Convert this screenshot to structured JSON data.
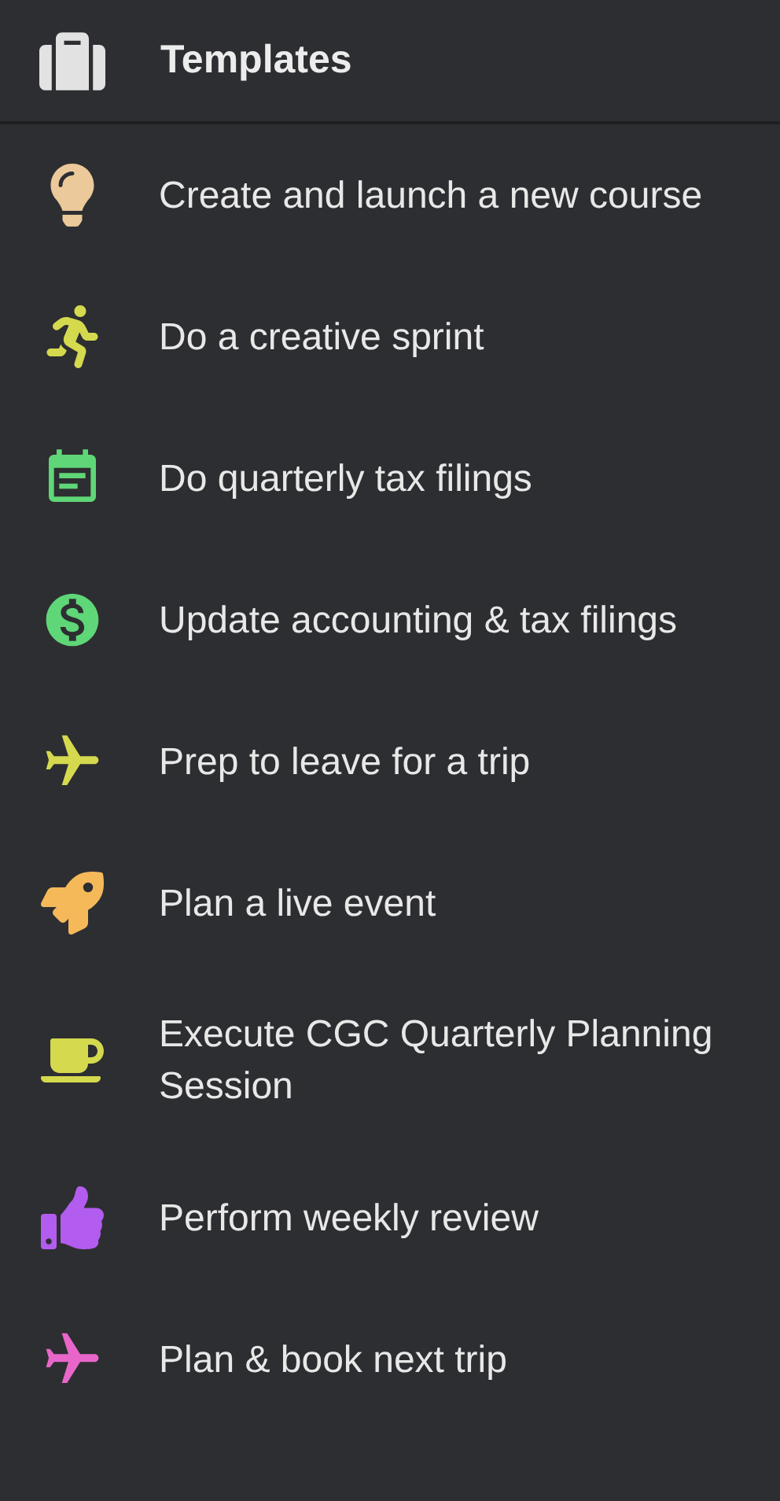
{
  "header": {
    "title": "Templates"
  },
  "templates": [
    {
      "label": "Create and launch a new course",
      "color": "#ebc99a"
    },
    {
      "label": "Do a creative sprint",
      "color": "#d4d94e"
    },
    {
      "label": "Do quarterly tax filings",
      "color": "#5fd677"
    },
    {
      "label": "Update accounting & tax filings",
      "color": "#5fd677"
    },
    {
      "label": "Prep to leave for a trip",
      "color": "#d4d94e"
    },
    {
      "label": "Plan a live event",
      "color": "#f5b95a"
    },
    {
      "label": "Execute CGC Quarterly Planning Session",
      "color": "#d4d94e"
    },
    {
      "label": "Perform weekly review",
      "color": "#b35cf0"
    },
    {
      "label": "Plan & book next trip",
      "color": "#e866c9"
    }
  ]
}
